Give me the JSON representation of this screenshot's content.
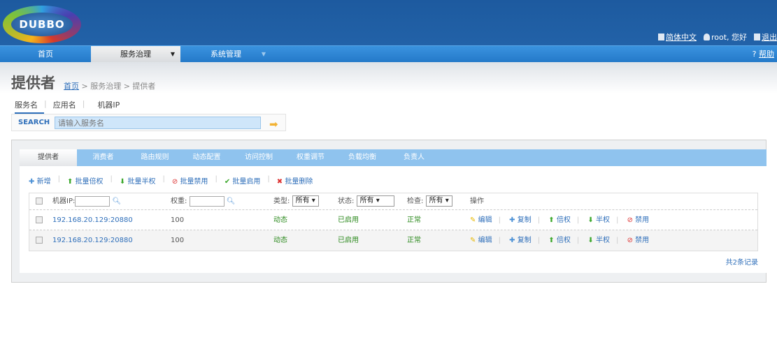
{
  "header": {
    "logo_text": "DUBBO",
    "language": "简体中文",
    "user": "root, 您好",
    "logout": "退出"
  },
  "nav": {
    "items": [
      {
        "label": "首页"
      },
      {
        "label": "服务治理"
      },
      {
        "label": "系统管理"
      }
    ],
    "help": "帮助"
  },
  "page": {
    "title": "提供者",
    "breadcrumb": {
      "home": "首页",
      "rest": " > 服务治理 > 提供者"
    }
  },
  "search": {
    "tabs": [
      "服务名",
      "应用名",
      "机器IP"
    ],
    "label": "SEARCH",
    "placeholder": "请输入服务名"
  },
  "tabs": [
    "提供者",
    "消费者",
    "路由规则",
    "动态配置",
    "访问控制",
    "权重调节",
    "负载均衡",
    "负责人"
  ],
  "toolbar": {
    "add": "新增",
    "double": "批量倍权",
    "half": "批量半权",
    "disable": "批量禁用",
    "enable": "批量启用",
    "delete": "批量删除"
  },
  "table": {
    "headers": {
      "ip": "机器IP:",
      "weight": "权重:",
      "type": "类型:",
      "status": "状态:",
      "check": "检查:",
      "ops": "操作"
    },
    "filters": {
      "type": "所有",
      "status": "所有",
      "check": "所有"
    },
    "rows": [
      {
        "ip": "192.168.20.129:20880",
        "weight": "100",
        "type": "动态",
        "status": "已启用",
        "check": "正常"
      },
      {
        "ip": "192.168.20.129:20880",
        "weight": "100",
        "type": "动态",
        "status": "已启用",
        "check": "正常"
      }
    ],
    "ops": {
      "edit": "编辑",
      "copy": "复制",
      "double": "倍权",
      "half": "半权",
      "disable": "禁用"
    }
  },
  "total": "共2条记录",
  "colors": {
    "header": "#1f5fa6",
    "nav": "#2f86d6",
    "tabstrip": "#8fc3ee",
    "link": "#2f6fba",
    "status_green": "#2c8a1e"
  }
}
